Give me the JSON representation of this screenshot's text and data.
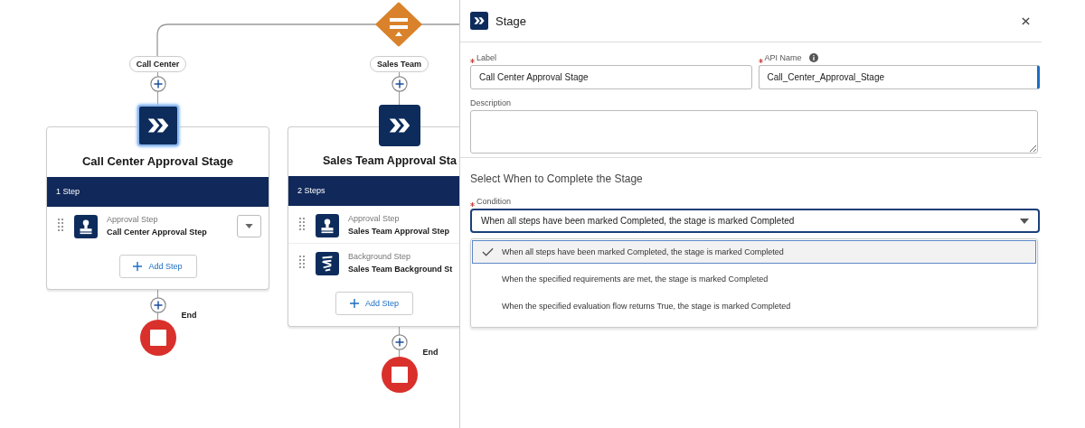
{
  "canvas": {
    "branches": [
      {
        "label": "Call Center",
        "stage": {
          "title": "Call Center Approval Stage",
          "selected": true,
          "step_count": "1 Step",
          "steps": [
            {
              "kind": "approval",
              "type": "Approval Step",
              "name": "Call Center Approval Step",
              "menu": true
            }
          ],
          "add_step": "Add Step"
        },
        "end": "End"
      },
      {
        "label": "Sales Team",
        "stage": {
          "title": "Sales Team Approval Sta",
          "selected": false,
          "step_count": "2 Steps",
          "steps": [
            {
              "kind": "approval",
              "type": "Approval Step",
              "name": "Sales Team Approval Step",
              "menu": false
            },
            {
              "kind": "background",
              "type": "Background Step",
              "name": "Sales Team Background St",
              "menu": false
            }
          ],
          "add_step": "Add Step"
        },
        "end": "End"
      }
    ]
  },
  "panel": {
    "title": "Stage",
    "fields": [
      {
        "label": "Label",
        "required": true,
        "info": false,
        "value": "Call Center Approval Stage"
      },
      {
        "label": "API Name",
        "required": true,
        "info": true,
        "value": "Call_Center_Approval_Stage"
      }
    ],
    "description": {
      "label": "Description",
      "required": false
    },
    "section_heading": "Select When to Complete the Stage",
    "condition": {
      "label": "Condition",
      "required": true,
      "value": "When all steps have been marked Completed, the stage is marked Completed",
      "options": [
        {
          "label": "When all steps have been marked Completed, the stage is marked Completed",
          "selected": true
        },
        {
          "label": "When the specified requirements are met, the stage is marked Completed",
          "selected": false
        },
        {
          "label": "When the specified evaluation flow returns True, the stage is marked Completed",
          "selected": false
        }
      ]
    }
  }
}
